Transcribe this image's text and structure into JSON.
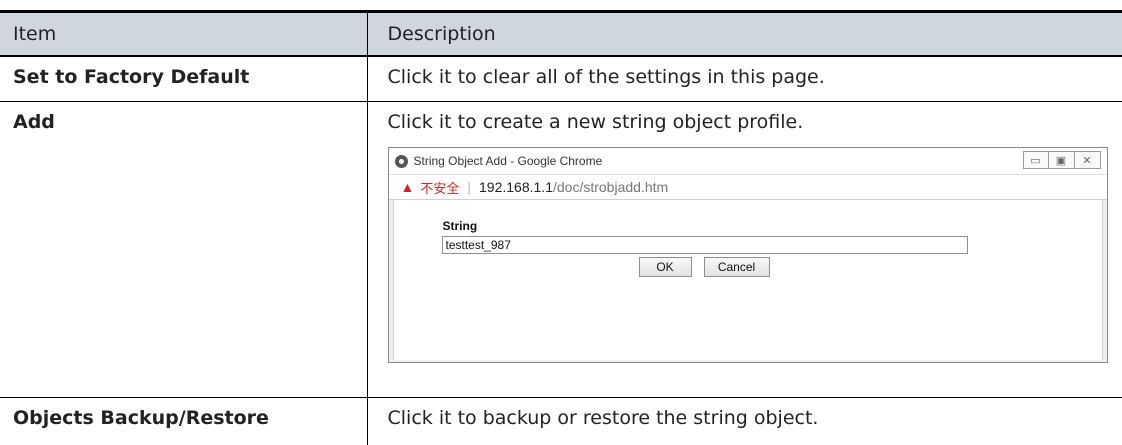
{
  "table": {
    "header_item": "Item",
    "header_description": "Description",
    "rows": [
      {
        "item": "Set to Factory Default",
        "description": "Click it to clear all of the settings in this page."
      },
      {
        "item": "Add",
        "description": "Click it to create a new string object profile."
      },
      {
        "item": "Objects Backup/Restore",
        "description": "Click it to backup or restore the string object."
      }
    ]
  },
  "window": {
    "title": "String Object Add - Google Chrome",
    "not_secure": "不安全",
    "url_host": "192.168.1.1",
    "url_path": "/doc/strobjadd.htm",
    "string_label": "String",
    "string_value": "testtest_987",
    "ok_label": "OK",
    "cancel_label": "Cancel",
    "icons": [
      "chrome-icon",
      "warning-icon",
      "minimize-icon",
      "maximize-icon",
      "close-icon"
    ]
  }
}
